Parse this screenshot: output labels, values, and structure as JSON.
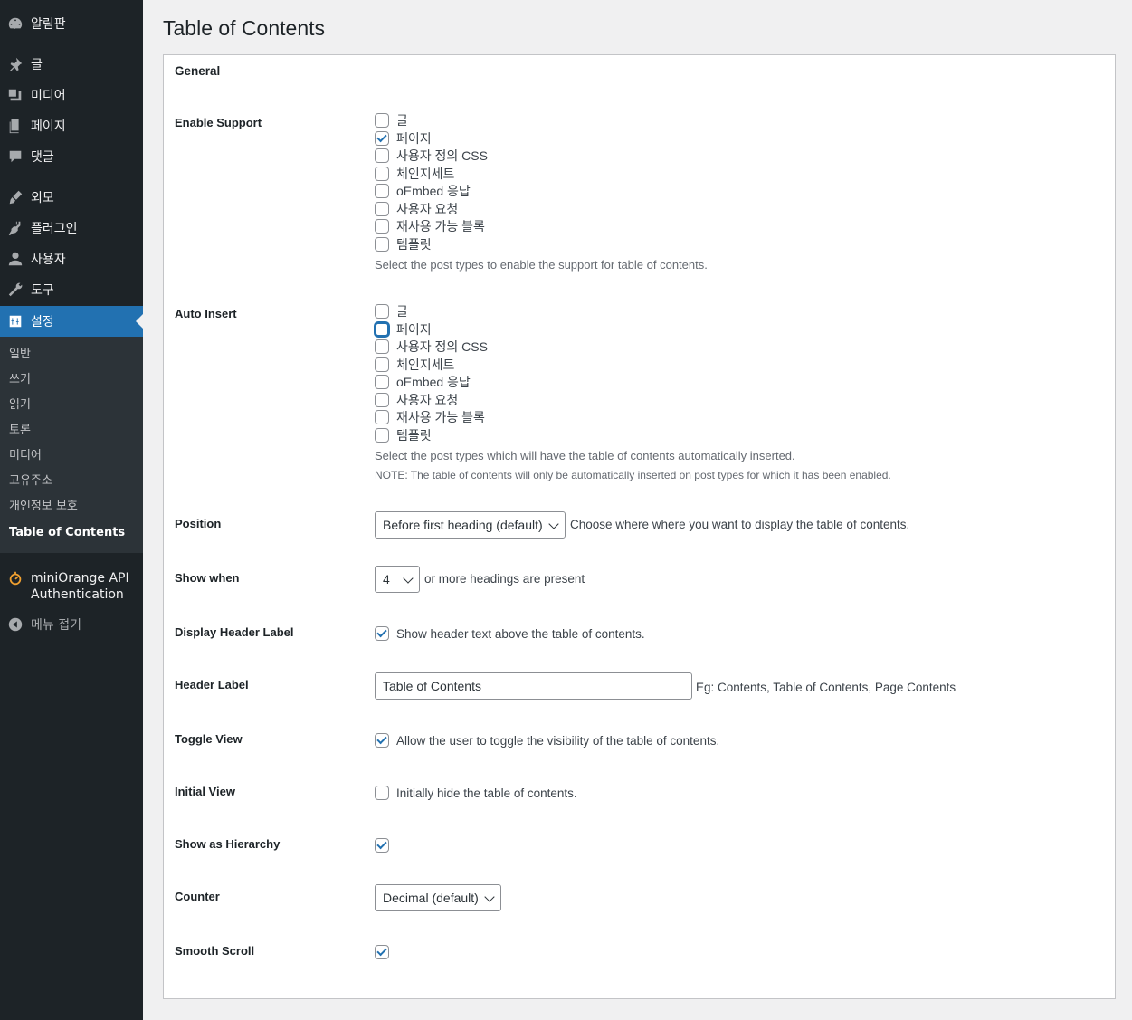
{
  "sidebar": {
    "items": [
      {
        "label": "알림판",
        "icon": "dashboard-icon"
      },
      {
        "label": "글",
        "icon": "pin-icon"
      },
      {
        "label": "미디어",
        "icon": "media-icon"
      },
      {
        "label": "페이지",
        "icon": "page-icon"
      },
      {
        "label": "댓글",
        "icon": "comment-icon"
      },
      {
        "label": "외모",
        "icon": "brush-icon"
      },
      {
        "label": "플러그인",
        "icon": "plugin-icon"
      },
      {
        "label": "사용자",
        "icon": "user-icon"
      },
      {
        "label": "도구",
        "icon": "wrench-icon"
      },
      {
        "label": "설정",
        "icon": "settings-icon"
      }
    ],
    "submenu": [
      "일반",
      "쓰기",
      "읽기",
      "토론",
      "미디어",
      "고유주소",
      "개인정보 보호",
      "Table of Contents"
    ],
    "plugin_item": {
      "label_line1": "miniOrange API",
      "label_line2": "Authentication",
      "icon": "miniorange-icon"
    },
    "collapse": {
      "label": "메뉴 접기",
      "icon": "collapse-arrow-icon"
    }
  },
  "page": {
    "title": "Table of Contents",
    "section": "General"
  },
  "post_types": [
    "글",
    "페이지",
    "사용자 정의 CSS",
    "체인지세트",
    "oEmbed 응답",
    "사용자 요청",
    "재사용 가능 블록",
    "템플릿"
  ],
  "enable_support": {
    "label": "Enable Support",
    "checked": [
      false,
      true,
      false,
      false,
      false,
      false,
      false,
      false
    ],
    "description": "Select the post types to enable the support for table of contents."
  },
  "auto_insert": {
    "label": "Auto Insert",
    "checked": [
      false,
      false,
      false,
      false,
      false,
      false,
      false,
      false
    ],
    "description": "Select the post types which will have the table of contents automatically inserted.",
    "note": "NOTE: The table of contents will only be automatically inserted on post types for which it has been enabled."
  },
  "position": {
    "label": "Position",
    "value": "Before first heading (default)",
    "help": "Choose where where you want to display the table of contents."
  },
  "show_when": {
    "label": "Show when",
    "value": "4",
    "help": "or more headings are present"
  },
  "display_header_label": {
    "label": "Display Header Label",
    "checked": true,
    "text": "Show header text above the table of contents."
  },
  "header_label": {
    "label": "Header Label",
    "value": "Table of Contents",
    "help": "Eg: Contents, Table of Contents, Page Contents"
  },
  "toggle_view": {
    "label": "Toggle View",
    "checked": true,
    "text": "Allow the user to toggle the visibility of the table of contents."
  },
  "initial_view": {
    "label": "Initial View",
    "checked": false,
    "text": "Initially hide the table of contents."
  },
  "show_as_hierarchy": {
    "label": "Show as Hierarchy",
    "checked": true
  },
  "counter": {
    "label": "Counter",
    "value": "Decimal (default)"
  },
  "smooth_scroll": {
    "label": "Smooth Scroll",
    "checked": true
  }
}
